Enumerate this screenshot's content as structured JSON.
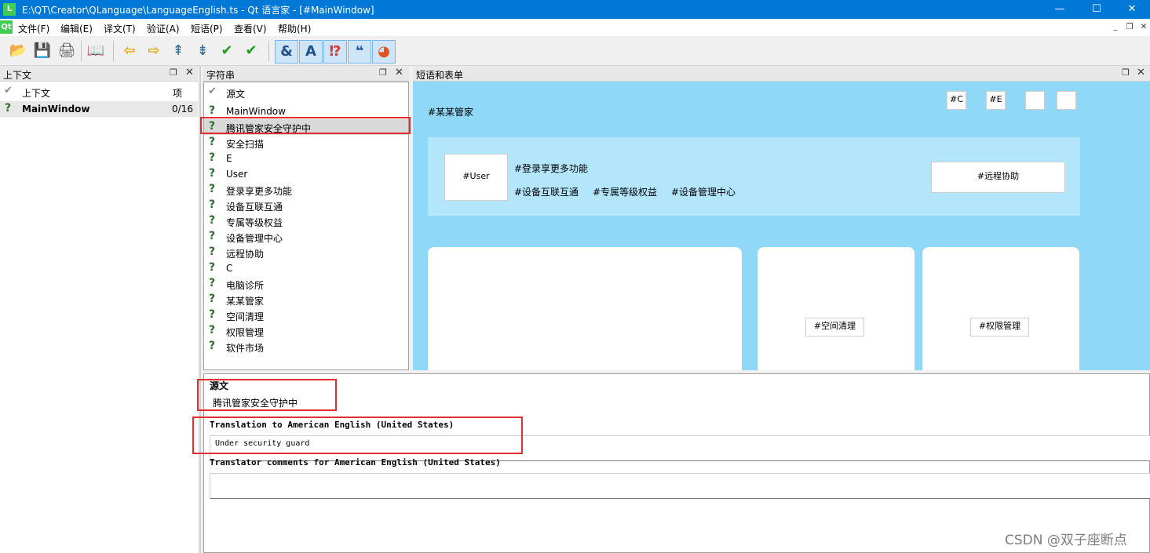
{
  "window": {
    "title": "E:\\QT\\Creator\\QLanguage\\LanguageEnglish.ts - Qt 语言家 - [#MainWindow]",
    "icon_label": "L",
    "controls": {
      "minimize": "—",
      "maximize": "☐",
      "close": "✕"
    }
  },
  "menubar": {
    "logo": "Qt",
    "items": [
      "文件(F)",
      "编辑(E)",
      "译文(T)",
      "验证(A)",
      "短语(P)",
      "查看(V)",
      "帮助(H)"
    ],
    "mdi": {
      "minimize": "_",
      "restore": "❐",
      "close": "✕"
    }
  },
  "toolbar": {
    "buttons": [
      {
        "name": "open-icon",
        "glyph": "📂"
      },
      {
        "name": "save-icon",
        "glyph": "💾"
      },
      {
        "name": "print-icon",
        "glyph": "🖨"
      },
      {
        "name": "phrasebook-icon",
        "glyph": "📖"
      },
      {
        "name": "prev-icon",
        "glyph": "⇦"
      },
      {
        "name": "next-icon",
        "glyph": "⇨"
      },
      {
        "name": "prev-unfinished-icon",
        "glyph": "⇞"
      },
      {
        "name": "next-unfinished-icon",
        "glyph": "⇟"
      },
      {
        "name": "done-icon",
        "glyph": "✔"
      },
      {
        "name": "done-next-icon",
        "glyph": "✔"
      },
      {
        "name": "accelerators-icon",
        "glyph": "&"
      },
      {
        "name": "punctuation-icon",
        "glyph": "A"
      },
      {
        "name": "phrase-matches-icon",
        "glyph": "⁉"
      },
      {
        "name": "placeholders-icon",
        "glyph": "❝"
      },
      {
        "name": "surrounding-whitespace-icon",
        "glyph": "◕"
      }
    ]
  },
  "context_panel": {
    "title": "上下文",
    "float": "❐",
    "close": "✕",
    "columns": {
      "context": "上下文",
      "items": "项"
    },
    "rows": [
      {
        "name": "MainWindow",
        "count": "0/16"
      }
    ]
  },
  "strings_panel": {
    "title": "字符串",
    "float": "❐",
    "close": "✕",
    "header": "源文",
    "items": [
      "MainWindow",
      "腾讯管家安全守护中",
      "安全扫描",
      "E",
      "User",
      "登录享更多功能",
      "设备互联互通",
      "专属等级权益",
      "设备管理中心",
      "远程协助",
      "C",
      "电脑诊所",
      "某某管家",
      "空间清理",
      "权限管理",
      "软件市场"
    ],
    "selected_index": 1
  },
  "form_panel": {
    "title": "短语和表单",
    "float": "❐",
    "close": "✕",
    "app_title": "#某某管家",
    "btn_c": "#C",
    "btn_e": "#E",
    "user": "#User",
    "login_more": "#登录享更多功能",
    "links": [
      "#设备互联互通",
      "#专属等级权益",
      "#设备管理中心"
    ],
    "remote": "#远程协助",
    "space_clean": "#空间清理",
    "permissions": "#权限管理"
  },
  "editor": {
    "source_label": "源文",
    "source_text": "腾讯管家安全守护中",
    "translation_label": "Translation to American English (United States)",
    "translation_value": "Under security guard",
    "comments_label": "Translator comments for American English (United States)",
    "comments_value": ""
  },
  "watermark": "CSDN @双子座断点",
  "colors": {
    "titlebar": "#0078d7",
    "form_bg": "#8fd8f8",
    "highlight": "#e52d2d",
    "qt_green": "#41cd52"
  }
}
